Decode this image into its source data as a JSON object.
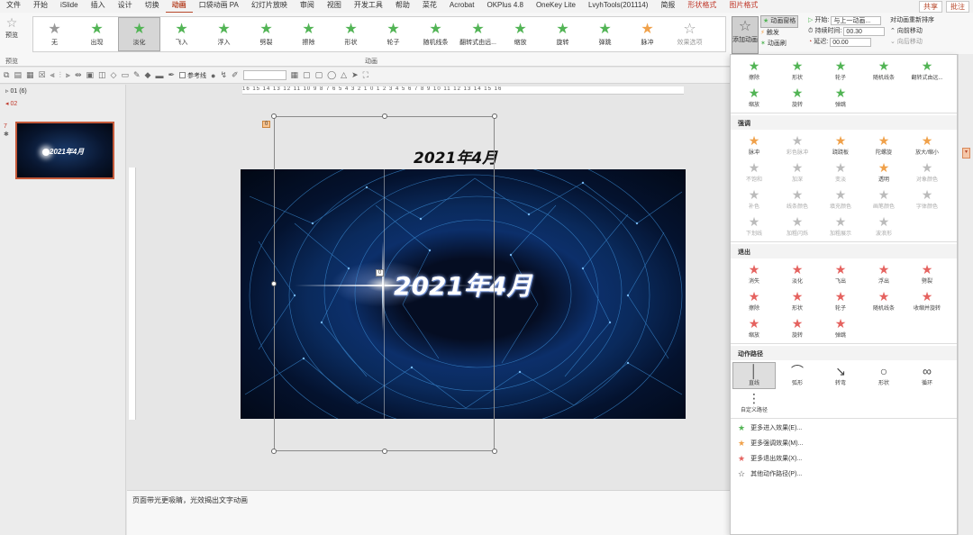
{
  "menu": {
    "items": [
      "文件",
      "开始",
      "iSlide",
      "插入",
      "设计",
      "切换",
      "动画",
      "口袋动画 PA",
      "幻灯片放映",
      "审阅",
      "视图",
      "开发工具",
      "帮助",
      "菜花",
      "Acrobat",
      "OKPlus 4.8",
      "OneKey Lite",
      "LvyhTools(201114)",
      "简报",
      "形状格式",
      "图片格式"
    ],
    "active_index": 6,
    "share": "共享",
    "comment": "批注"
  },
  "ribbon": {
    "preview_label": "预览",
    "preview_group": "预览",
    "anim_group": "动画",
    "gallery": [
      {
        "label": "无",
        "icon": "star-icon",
        "color": "#9a9a9a"
      },
      {
        "label": "出现",
        "icon": "star-icon",
        "color": "#52b455"
      },
      {
        "label": "淡化",
        "icon": "star-icon",
        "color": "#52b455",
        "selected": true
      },
      {
        "label": "飞入",
        "icon": "star-icon",
        "color": "#52b455"
      },
      {
        "label": "浮入",
        "icon": "star-icon",
        "color": "#52b455"
      },
      {
        "label": "劈裂",
        "icon": "star-icon",
        "color": "#52b455"
      },
      {
        "label": "擦除",
        "icon": "star-icon",
        "color": "#52b455"
      },
      {
        "label": "形状",
        "icon": "star-icon",
        "color": "#52b455"
      },
      {
        "label": "轮子",
        "icon": "star-icon",
        "color": "#52b455"
      },
      {
        "label": "随机线条",
        "icon": "star-icon",
        "color": "#52b455"
      },
      {
        "label": "翻转式由远...",
        "icon": "star-icon",
        "color": "#52b455"
      },
      {
        "label": "缩放",
        "icon": "star-icon",
        "color": "#52b455"
      },
      {
        "label": "旋转",
        "icon": "star-icon",
        "color": "#52b455"
      },
      {
        "label": "弹跳",
        "icon": "star-icon",
        "color": "#52b455"
      },
      {
        "label": "脉冲",
        "icon": "star-icon",
        "color": "#f0a14a"
      }
    ],
    "effect_options": "效果选项",
    "add_animation": "添加动画",
    "anim_pane": "动画窗格",
    "trigger": "触发",
    "anim_brush": "动画刷",
    "start_label": "开始:",
    "start_value": "与上一动画...",
    "duration_label": "持续时间:",
    "duration_value": "00.30",
    "delay_label": "延迟:",
    "delay_value": "00.00",
    "reorder_title": "对动画重新排序",
    "move_earlier": "向前移动",
    "move_later": "向后移动"
  },
  "toolbar": {
    "guides_label": "参考线"
  },
  "slides_pane": {
    "section1": "01 (6)",
    "section2": "02",
    "slide_number": "7",
    "thumb_title": "2021年4月"
  },
  "canvas": {
    "ruler_h": "16 15 14 13 12 11 10 9 8 7 6 5 4 3 2 1 0 1 2 3 4 5 6 7 8 9 10 11 12 13 14 15 16",
    "title_above": "2021年4月",
    "slide_title": "2021年4月",
    "tag_top": "0",
    "tag_mid": "0"
  },
  "notes": {
    "text": "页面带光更吸睛，光效揭出文字动画"
  },
  "dropdown": {
    "entrance_top": [
      {
        "label": "擦除",
        "color": "green"
      },
      {
        "label": "形状",
        "color": "green"
      },
      {
        "label": "轮子",
        "color": "green"
      },
      {
        "label": "随机线条",
        "color": "green"
      },
      {
        "label": "翻转式由远...",
        "color": "green"
      },
      {
        "label": "缩放",
        "color": "green"
      },
      {
        "label": "旋转",
        "color": "green"
      },
      {
        "label": "弹跳",
        "color": "green"
      }
    ],
    "emphasis_title": "强调",
    "emphasis": [
      {
        "label": "脉冲",
        "color": "orange"
      },
      {
        "label": "彩色脉冲",
        "color": "gray",
        "dim": true
      },
      {
        "label": "跷跷板",
        "color": "orange"
      },
      {
        "label": "陀螺旋",
        "color": "orange"
      },
      {
        "label": "放大/缩小",
        "color": "orange"
      },
      {
        "label": "不饱和",
        "color": "gray",
        "dim": true
      },
      {
        "label": "加深",
        "color": "gray",
        "dim": true
      },
      {
        "label": "变淡",
        "color": "gray",
        "dim": true
      },
      {
        "label": "透明",
        "color": "orange"
      },
      {
        "label": "对象颜色",
        "color": "gray",
        "dim": true
      },
      {
        "label": "补色",
        "color": "gray",
        "dim": true
      },
      {
        "label": "线条颜色",
        "color": "gray",
        "dim": true
      },
      {
        "label": "填充颜色",
        "color": "gray",
        "dim": true
      },
      {
        "label": "画笔颜色",
        "color": "gray",
        "dim": true
      },
      {
        "label": "字体颜色",
        "color": "gray",
        "dim": true
      },
      {
        "label": "下划线",
        "color": "gray",
        "dim": true
      },
      {
        "label": "加粗闪烁",
        "color": "gray",
        "dim": true
      },
      {
        "label": "加粗展示",
        "color": "gray",
        "dim": true
      },
      {
        "label": "波浪形",
        "color": "gray",
        "dim": true
      }
    ],
    "exit_title": "退出",
    "exit": [
      {
        "label": "消失",
        "color": "red"
      },
      {
        "label": "淡化",
        "color": "red"
      },
      {
        "label": "飞出",
        "color": "red"
      },
      {
        "label": "浮出",
        "color": "red"
      },
      {
        "label": "劈裂",
        "color": "red"
      },
      {
        "label": "擦除",
        "color": "red"
      },
      {
        "label": "形状",
        "color": "red"
      },
      {
        "label": "轮子",
        "color": "red"
      },
      {
        "label": "随机线条",
        "color": "red"
      },
      {
        "label": "收缩并旋转",
        "color": "red"
      },
      {
        "label": "缩放",
        "color": "red"
      },
      {
        "label": "旋转",
        "color": "red"
      },
      {
        "label": "弹跳",
        "color": "red"
      }
    ],
    "path_title": "动作路径",
    "paths": [
      {
        "label": "直线",
        "glyph": "│",
        "selected": true
      },
      {
        "label": "弧形",
        "glyph": "⌒"
      },
      {
        "label": "转弯",
        "glyph": "↘"
      },
      {
        "label": "形状",
        "glyph": "○"
      },
      {
        "label": "循环",
        "glyph": "∞"
      },
      {
        "label": "自定义路径",
        "glyph": "⋮"
      }
    ],
    "more": [
      {
        "label": "更多进入效果(E)...",
        "color": "green"
      },
      {
        "label": "更多强调效果(M)...",
        "color": "orange"
      },
      {
        "label": "更多退出效果(X)...",
        "color": "red"
      },
      {
        "label": "其他动作路径(P)...",
        "color": "path"
      }
    ]
  }
}
